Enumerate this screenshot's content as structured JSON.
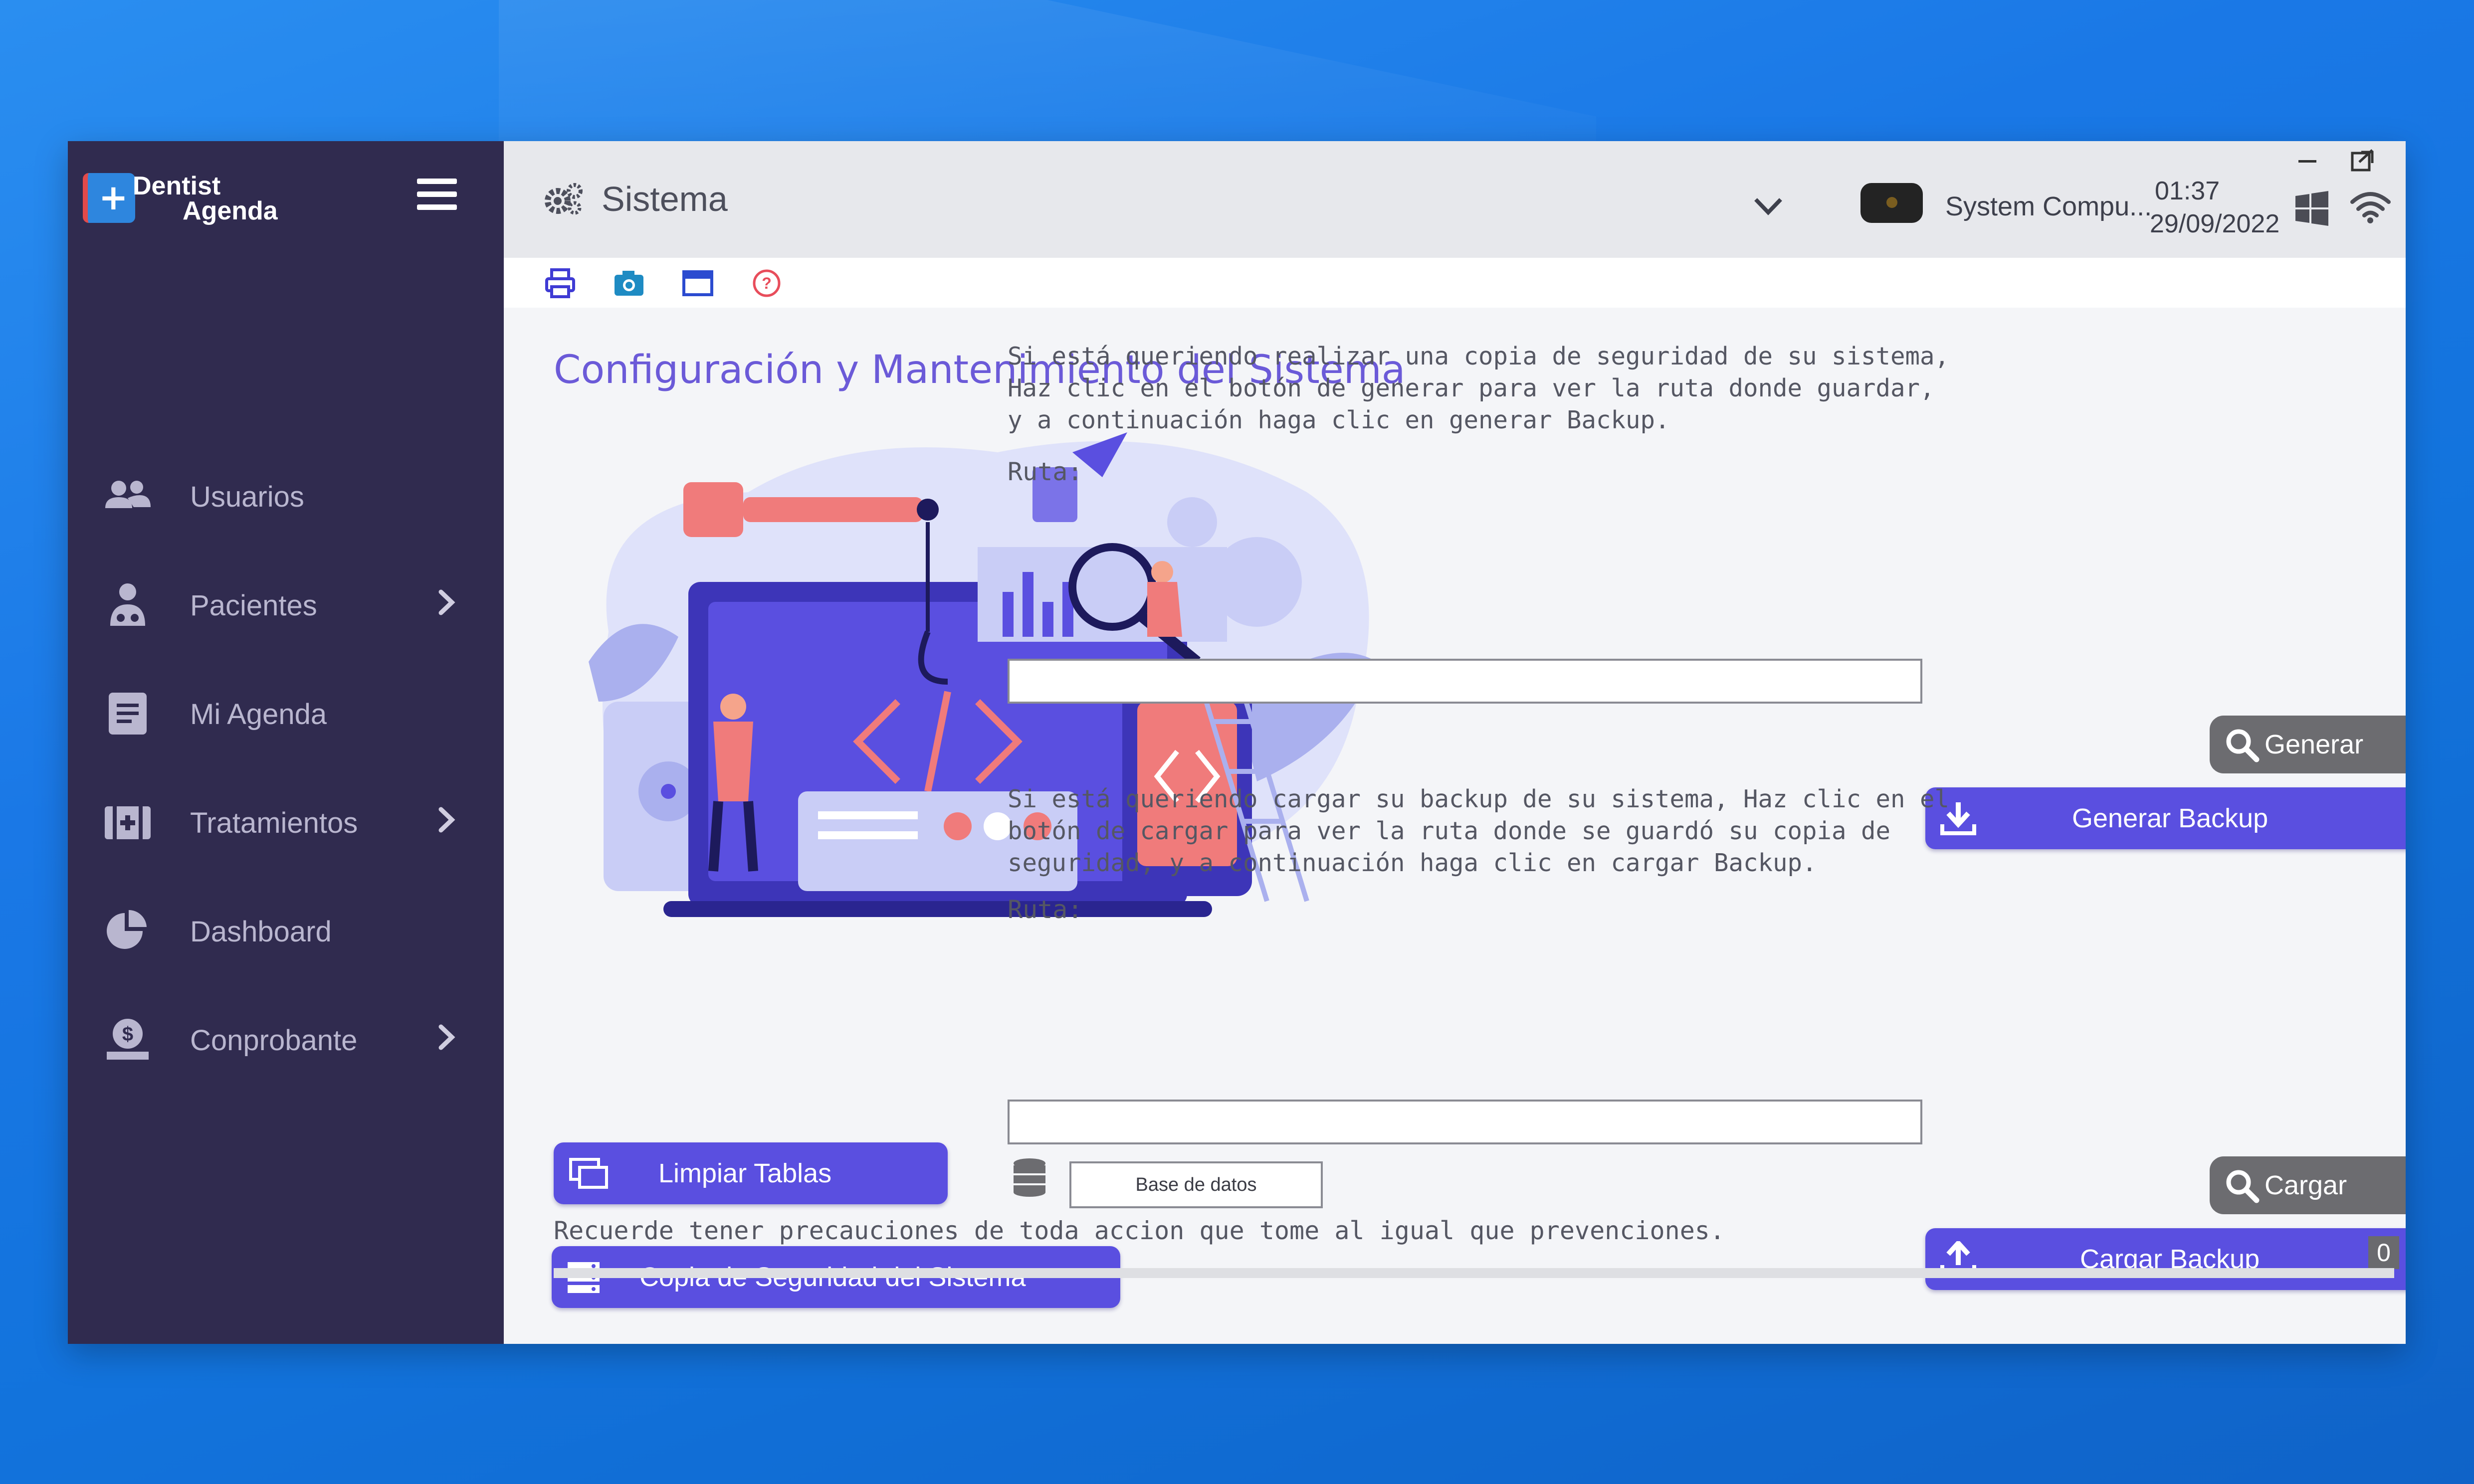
{
  "app": {
    "logo_line1": "Dentist",
    "logo_line2": "Agenda"
  },
  "sidebar": {
    "items": [
      {
        "label": "Usuarios",
        "icon": "users-icon",
        "has_submenu": false
      },
      {
        "label": "Pacientes",
        "icon": "patient-icon",
        "has_submenu": true
      },
      {
        "label": "Mi Agenda",
        "icon": "agenda-icon",
        "has_submenu": false
      },
      {
        "label": "Tratamientos",
        "icon": "medical-kit-icon",
        "has_submenu": true
      },
      {
        "label": "Dashboard",
        "icon": "pie-chart-icon",
        "has_submenu": false
      },
      {
        "label": "Conprobante",
        "icon": "money-icon",
        "has_submenu": true
      }
    ]
  },
  "header": {
    "title": "Sistema",
    "system_name": "System Compu...",
    "time": "01:37",
    "date": "29/09/2022"
  },
  "toolbar": {
    "icons": [
      "printer-icon",
      "camera-icon",
      "window-icon",
      "help-icon"
    ]
  },
  "main": {
    "title": "Configuración y Mantenimiento del Sistema",
    "clean_tables_label": "Limpiar Tablas",
    "backup_system_label": "Copia de Seguridad del Sistema",
    "backup_section": {
      "info": "Si está queriendo realizar una copia de seguridad de su sistema, Haz clic en el botón de generar para ver la ruta donde guardar, y a continuación haga clic en generar Backup.",
      "ruta_label": "Ruta:",
      "ruta_value": "",
      "generate_label": "Generar",
      "generate_backup_label": "Generar Backup"
    },
    "restore_section": {
      "info": "Si está queriendo cargar su backup de su sistema, Haz clic en el botón de cargar para ver la ruta donde se guardó su copia de seguridad, y a continuación haga clic en cargar Backup.",
      "ruta_label": "Ruta:",
      "ruta_value": "",
      "database_value": "Base de datos",
      "load_label": "Cargar",
      "load_backup_label": "Cargar Backup"
    },
    "footer_note": "Recuerde tener precauciones de toda accion que tome al igual que prevenciones.",
    "counter": "0"
  },
  "colors": {
    "sidebar_bg": "#302b4f",
    "accent_purple": "#5a4fe0",
    "title_purple": "#6b5ad8",
    "grey_button": "#6c6c70"
  }
}
